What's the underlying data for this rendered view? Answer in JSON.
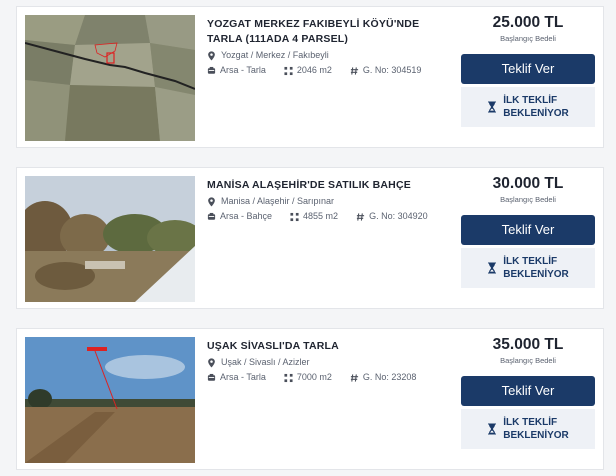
{
  "colors": {
    "primary": "#1b3a68",
    "card_bg": "#ffffff",
    "page_bg": "#f4f5f7",
    "muted": "#5b6270"
  },
  "listings": [
    {
      "title": "YOZGAT MERKEZ FAKIBEYLİ KÖYÜ'NDE TARLA (111ADA 4 PARSEL)",
      "location": "Yozgat / Merkez / Fakıbeyli",
      "type": "Arsa - Tarla",
      "area": "2046 m2",
      "listing_no": "G. No: 304519",
      "price": "25.000 TL",
      "price_label": "Başlangıç Bedeli",
      "offer_button": "Teklif Ver",
      "status": "İLK TEKLİF\nBEKLENİYOR",
      "thumb": "aerial-map"
    },
    {
      "title": "MANİSA ALAŞEHİR'DE SATILIK BAHÇE",
      "location": "Manisa / Alaşehir / Sarıpınar",
      "type": "Arsa - Bahçe",
      "area": "4855 m2",
      "listing_no": "G. No: 304920",
      "price": "30.000 TL",
      "price_label": "Başlangıç Bedeli",
      "offer_button": "Teklif Ver",
      "status": "İLK TEKLİF\nBEKLENİYOR",
      "thumb": "orchard-photo"
    },
    {
      "title": "UŞAK SİVASLI'DA TARLA",
      "location": "Uşak / Sivaslı / Azizler",
      "type": "Arsa - Tarla",
      "area": "7000 m2",
      "listing_no": "G. No: 23208",
      "price": "35.000 TL",
      "price_label": "Başlangıç Bedeli",
      "offer_button": "Teklif Ver",
      "status": "İLK TEKLİF\nBEKLENİYOR",
      "thumb": "field-photo"
    }
  ]
}
